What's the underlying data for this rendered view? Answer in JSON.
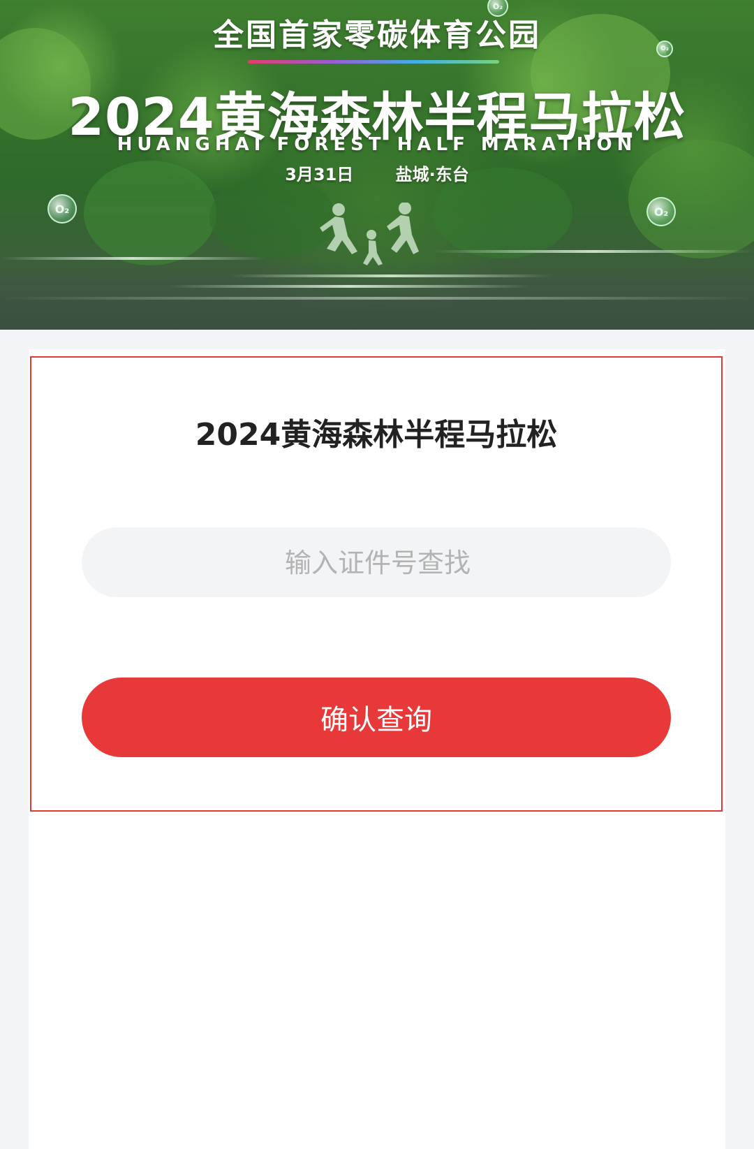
{
  "banner": {
    "slogan": "全国首家零碳体育公园",
    "title": "2024黄海森林半程马拉松",
    "subtitle_en": "HUANGHAI FOREST HALF MARATHON",
    "date": "3月31日",
    "location": "盐城·东台",
    "bubble_label": "O₂"
  },
  "card": {
    "title": "2024黄海森林半程马拉松",
    "search_placeholder": "输入证件号查找",
    "search_value": "",
    "confirm_label": "确认查询"
  },
  "colors": {
    "accent": "#e8393a",
    "card_border": "#e53935",
    "page_bg": "#f3f4f6",
    "input_bg": "#f3f4f6"
  }
}
